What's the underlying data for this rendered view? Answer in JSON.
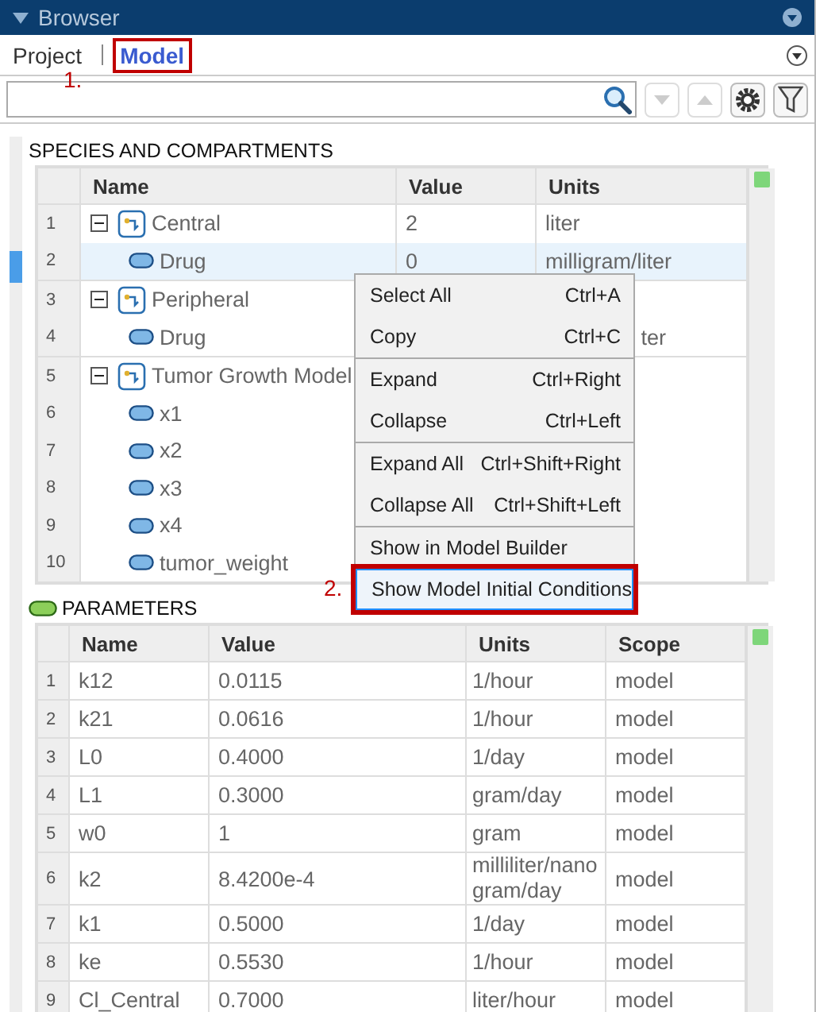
{
  "window": {
    "title": "Browser"
  },
  "tabs": [
    {
      "label": "Project",
      "selected": false,
      "annotated": false
    },
    {
      "label": "Model",
      "selected": true,
      "annotated": true
    }
  ],
  "annotations": [
    {
      "label": "1."
    },
    {
      "label": "2."
    }
  ],
  "toolbar": {
    "down_disabled": true,
    "up_disabled": true
  },
  "species": {
    "title": "SPECIES AND COMPARTMENTS",
    "columns": [
      "Name",
      "Value",
      "Units"
    ],
    "rows": [
      {
        "num": "1",
        "name": "Central",
        "value": "2",
        "units": "liter",
        "expanded": true,
        "selected": false,
        "children": [
          {
            "num": "2",
            "name": "Drug",
            "value": "0",
            "units": "milligram/liter",
            "selected": true
          }
        ]
      },
      {
        "num": "3",
        "name": "Peripheral",
        "expanded": true,
        "selected": false,
        "children": [
          {
            "num": "4",
            "name": "Drug",
            "units": "ter",
            "units_cut": true,
            "selected": false
          }
        ]
      },
      {
        "num": "5",
        "name": "Tumor Growth Model",
        "expanded": true,
        "selected": false,
        "children": [
          {
            "num": "6",
            "name": "x1",
            "selected": false
          },
          {
            "num": "7",
            "name": "x2",
            "selected": false
          },
          {
            "num": "8",
            "name": "x3",
            "selected": false
          },
          {
            "num": "9",
            "name": "x4",
            "selected": false
          },
          {
            "num": "10",
            "name": "tumor_weight",
            "selected": false
          }
        ]
      }
    ]
  },
  "parameters": {
    "title": "PARAMETERS",
    "columns": [
      "Name",
      "Value",
      "Units",
      "Scope"
    ],
    "rows": [
      {
        "num": "1",
        "name": "k12",
        "value": "0.0115",
        "units": "1/hour",
        "scope": "model"
      },
      {
        "num": "2",
        "name": "k21",
        "value": "0.0616",
        "units": "1/hour",
        "scope": "model"
      },
      {
        "num": "3",
        "name": "L0",
        "value": "0.4000",
        "units": "1/day",
        "scope": "model"
      },
      {
        "num": "4",
        "name": "L1",
        "value": "0.3000",
        "units": "gram/day",
        "scope": "model"
      },
      {
        "num": "5",
        "name": "w0",
        "value": "1",
        "units": "gram",
        "scope": "model"
      },
      {
        "num": "6",
        "name": "k2",
        "value": "8.4200e-4",
        "units": "milliliter/nanogram/day",
        "scope": "model"
      },
      {
        "num": "7",
        "name": "k1",
        "value": "0.5000",
        "units": "1/day",
        "scope": "model"
      },
      {
        "num": "8",
        "name": "ke",
        "value": "0.5530",
        "units": "1/hour",
        "scope": "model"
      },
      {
        "num": "9",
        "name": "Cl_Central",
        "value": "0.7000",
        "units": "liter/hour",
        "scope": "model"
      }
    ]
  },
  "context_menu": {
    "groups": [
      [
        {
          "label": "Select All",
          "shortcut": "Ctrl+A",
          "selected": false
        },
        {
          "label": "Copy",
          "shortcut": "Ctrl+C",
          "selected": false
        }
      ],
      [
        {
          "label": "Expand",
          "shortcut": "Ctrl+Right",
          "selected": false
        },
        {
          "label": "Collapse",
          "shortcut": "Ctrl+Left",
          "selected": false
        }
      ],
      [
        {
          "label": "Expand All",
          "shortcut": "Ctrl+Shift+Right",
          "selected": false
        },
        {
          "label": "Collapse All",
          "shortcut": "Ctrl+Shift+Left",
          "selected": false
        }
      ],
      [
        {
          "label": "Show in Model Builder",
          "selected": false
        },
        {
          "label": "Show Model Initial Conditions",
          "selected": true,
          "annotated": true
        }
      ]
    ]
  }
}
